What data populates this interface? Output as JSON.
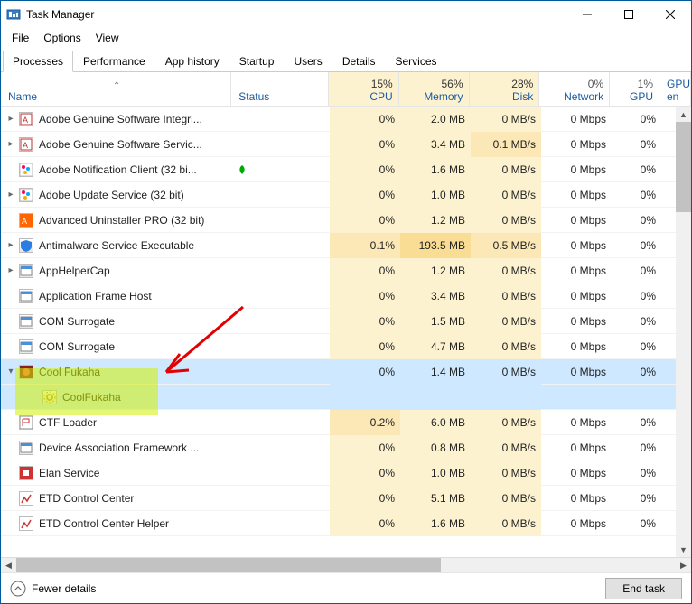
{
  "window": {
    "title": "Task Manager"
  },
  "menu": {
    "file": "File",
    "options": "Options",
    "view": "View"
  },
  "tabs": [
    "Processes",
    "Performance",
    "App history",
    "Startup",
    "Users",
    "Details",
    "Services"
  ],
  "activeTab": 0,
  "columns": {
    "name": "Name",
    "status": "Status",
    "cpu": {
      "pct": "15%",
      "label": "CPU"
    },
    "mem": {
      "pct": "56%",
      "label": "Memory"
    },
    "disk": {
      "pct": "28%",
      "label": "Disk"
    },
    "net": {
      "pct": "0%",
      "label": "Network"
    },
    "gpu": {
      "pct": "1%",
      "label": "GPU"
    },
    "gpue": "GPU en"
  },
  "footer": {
    "fewer": "Fewer details",
    "endTask": "End task"
  },
  "rows": [
    {
      "exp": ">",
      "name": "Adobe Genuine Software Integri...",
      "status": "",
      "cpu": "0%",
      "mem": "2.0 MB",
      "disk": "0 MB/s",
      "net": "0 Mbps",
      "gpu": "0%",
      "icon": "adobe"
    },
    {
      "exp": ">",
      "name": "Adobe Genuine Software Servic...",
      "status": "",
      "cpu": "0%",
      "mem": "3.4 MB",
      "disk": "0.1 MB/s",
      "net": "0 Mbps",
      "gpu": "0%",
      "icon": "adobe",
      "diskShade": 1
    },
    {
      "exp": "",
      "name": "Adobe Notification Client (32 bi...",
      "status": "leaf",
      "cpu": "0%",
      "mem": "1.6 MB",
      "disk": "0 MB/s",
      "net": "0 Mbps",
      "gpu": "0%",
      "icon": "adobe-cc"
    },
    {
      "exp": ">",
      "name": "Adobe Update Service (32 bit)",
      "status": "",
      "cpu": "0%",
      "mem": "1.0 MB",
      "disk": "0 MB/s",
      "net": "0 Mbps",
      "gpu": "0%",
      "icon": "adobe-cc"
    },
    {
      "exp": "",
      "name": "Advanced Uninstaller PRO (32 bit)",
      "status": "",
      "cpu": "0%",
      "mem": "1.2 MB",
      "disk": "0 MB/s",
      "net": "0 Mbps",
      "gpu": "0%",
      "icon": "au"
    },
    {
      "exp": ">",
      "name": "Antimalware Service Executable",
      "status": "",
      "cpu": "0.1%",
      "mem": "193.5 MB",
      "disk": "0.5 MB/s",
      "net": "0 Mbps",
      "gpu": "0%",
      "icon": "shield",
      "cpuShade": 1,
      "memShade": 2,
      "diskShade": 1
    },
    {
      "exp": ">",
      "name": "AppHelperCap",
      "status": "",
      "cpu": "0%",
      "mem": "1.2 MB",
      "disk": "0 MB/s",
      "net": "0 Mbps",
      "gpu": "0%",
      "icon": "app"
    },
    {
      "exp": "",
      "name": "Application Frame Host",
      "status": "",
      "cpu": "0%",
      "mem": "3.4 MB",
      "disk": "0 MB/s",
      "net": "0 Mbps",
      "gpu": "0%",
      "icon": "app"
    },
    {
      "exp": "",
      "name": "COM Surrogate",
      "status": "",
      "cpu": "0%",
      "mem": "1.5 MB",
      "disk": "0 MB/s",
      "net": "0 Mbps",
      "gpu": "0%",
      "icon": "app"
    },
    {
      "exp": "",
      "name": "COM Surrogate",
      "status": "",
      "cpu": "0%",
      "mem": "4.7 MB",
      "disk": "0 MB/s",
      "net": "0 Mbps",
      "gpu": "0%",
      "icon": "app"
    },
    {
      "exp": "v",
      "name": "Cool Fukaha",
      "status": "",
      "cpu": "0%",
      "mem": "1.4 MB",
      "disk": "0 MB/s",
      "net": "0 Mbps",
      "gpu": "0%",
      "icon": "cf",
      "selected": true
    },
    {
      "exp": "",
      "name": "CoolFukaha",
      "status": "",
      "cpu": "",
      "mem": "",
      "disk": "",
      "net": "",
      "gpu": "",
      "icon": "gear",
      "selected": true,
      "child": true
    },
    {
      "exp": "",
      "name": "CTF Loader",
      "status": "",
      "cpu": "0.2%",
      "mem": "6.0 MB",
      "disk": "0 MB/s",
      "net": "0 Mbps",
      "gpu": "0%",
      "icon": "ctf",
      "cpuShade": 1
    },
    {
      "exp": "",
      "name": "Device Association Framework ...",
      "status": "",
      "cpu": "0%",
      "mem": "0.8 MB",
      "disk": "0 MB/s",
      "net": "0 Mbps",
      "gpu": "0%",
      "icon": "app"
    },
    {
      "exp": "",
      "name": "Elan Service",
      "status": "",
      "cpu": "0%",
      "mem": "1.0 MB",
      "disk": "0 MB/s",
      "net": "0 Mbps",
      "gpu": "0%",
      "icon": "elan"
    },
    {
      "exp": "",
      "name": "ETD Control Center",
      "status": "",
      "cpu": "0%",
      "mem": "5.1 MB",
      "disk": "0 MB/s",
      "net": "0 Mbps",
      "gpu": "0%",
      "icon": "etd"
    },
    {
      "exp": "",
      "name": "ETD Control Center Helper",
      "status": "",
      "cpu": "0%",
      "mem": "1.6 MB",
      "disk": "0 MB/s",
      "net": "0 Mbps",
      "gpu": "0%",
      "icon": "etd"
    }
  ]
}
